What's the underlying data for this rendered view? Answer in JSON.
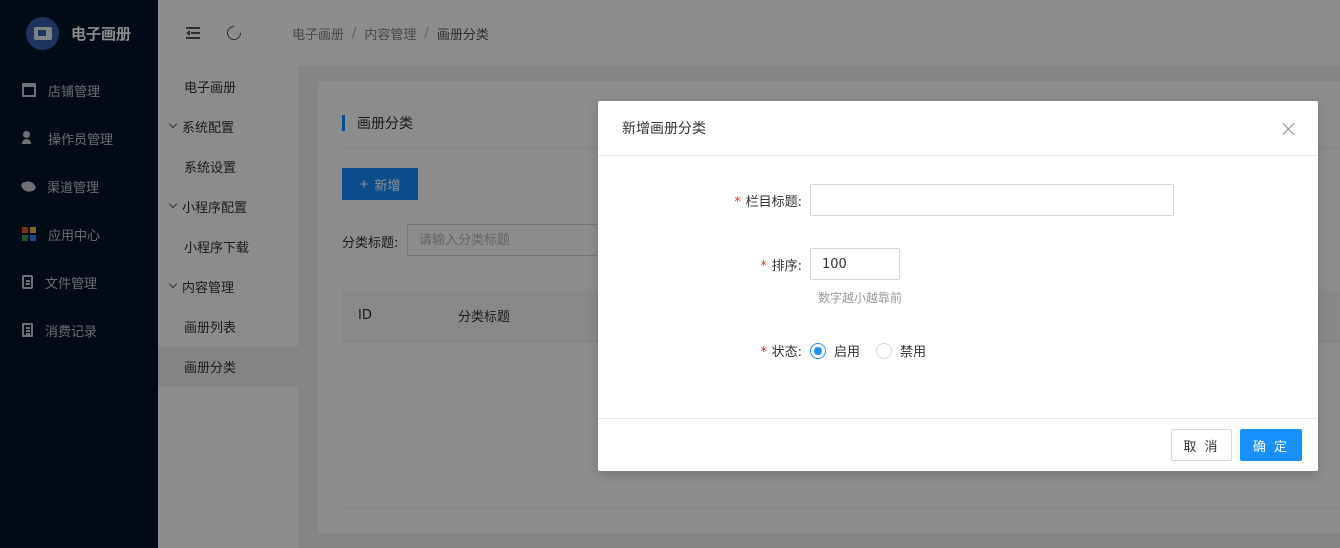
{
  "app": {
    "title": "电子画册"
  },
  "sidebar": {
    "items": [
      {
        "label": "店铺管理",
        "icon": "store-icon"
      },
      {
        "label": "操作员管理",
        "icon": "operator-icon"
      },
      {
        "label": "渠道管理",
        "icon": "channel-icon"
      },
      {
        "label": "应用中心",
        "icon": "apps-icon"
      },
      {
        "label": "文件管理",
        "icon": "file-icon"
      },
      {
        "label": "消费记录",
        "icon": "record-icon"
      }
    ]
  },
  "subnav": {
    "top": "电子画册",
    "groups": [
      {
        "label": "系统配置",
        "items": [
          "系统设置"
        ]
      },
      {
        "label": "小程序配置",
        "items": [
          "小程序下载"
        ]
      },
      {
        "label": "内容管理",
        "items": [
          "画册列表",
          "画册分类"
        ]
      }
    ],
    "active": "画册分类"
  },
  "header": {
    "breadcrumb": [
      "电子画册",
      "内容管理",
      "画册分类"
    ],
    "separator": "/"
  },
  "page": {
    "title": "画册分类",
    "add_label": "新增",
    "filter_label": "分类标题:",
    "filter_placeholder": "请输入分类标题",
    "columns": [
      "ID",
      "分类标题"
    ]
  },
  "modal": {
    "title": "新增画册分类",
    "fields": {
      "title_label": "栏目标题:",
      "title_value": "",
      "sort_label": "排序:",
      "sort_value": "100",
      "sort_hint": "数字越小越靠前",
      "status_label": "状态:",
      "status_options": [
        "启用",
        "禁用"
      ],
      "status_selected": "启用"
    },
    "cancel_label": "取 消",
    "ok_label": "确 定"
  },
  "colors": {
    "primary": "#1890ff",
    "sidebar_bg": "#001529",
    "required": "#f5222d"
  }
}
